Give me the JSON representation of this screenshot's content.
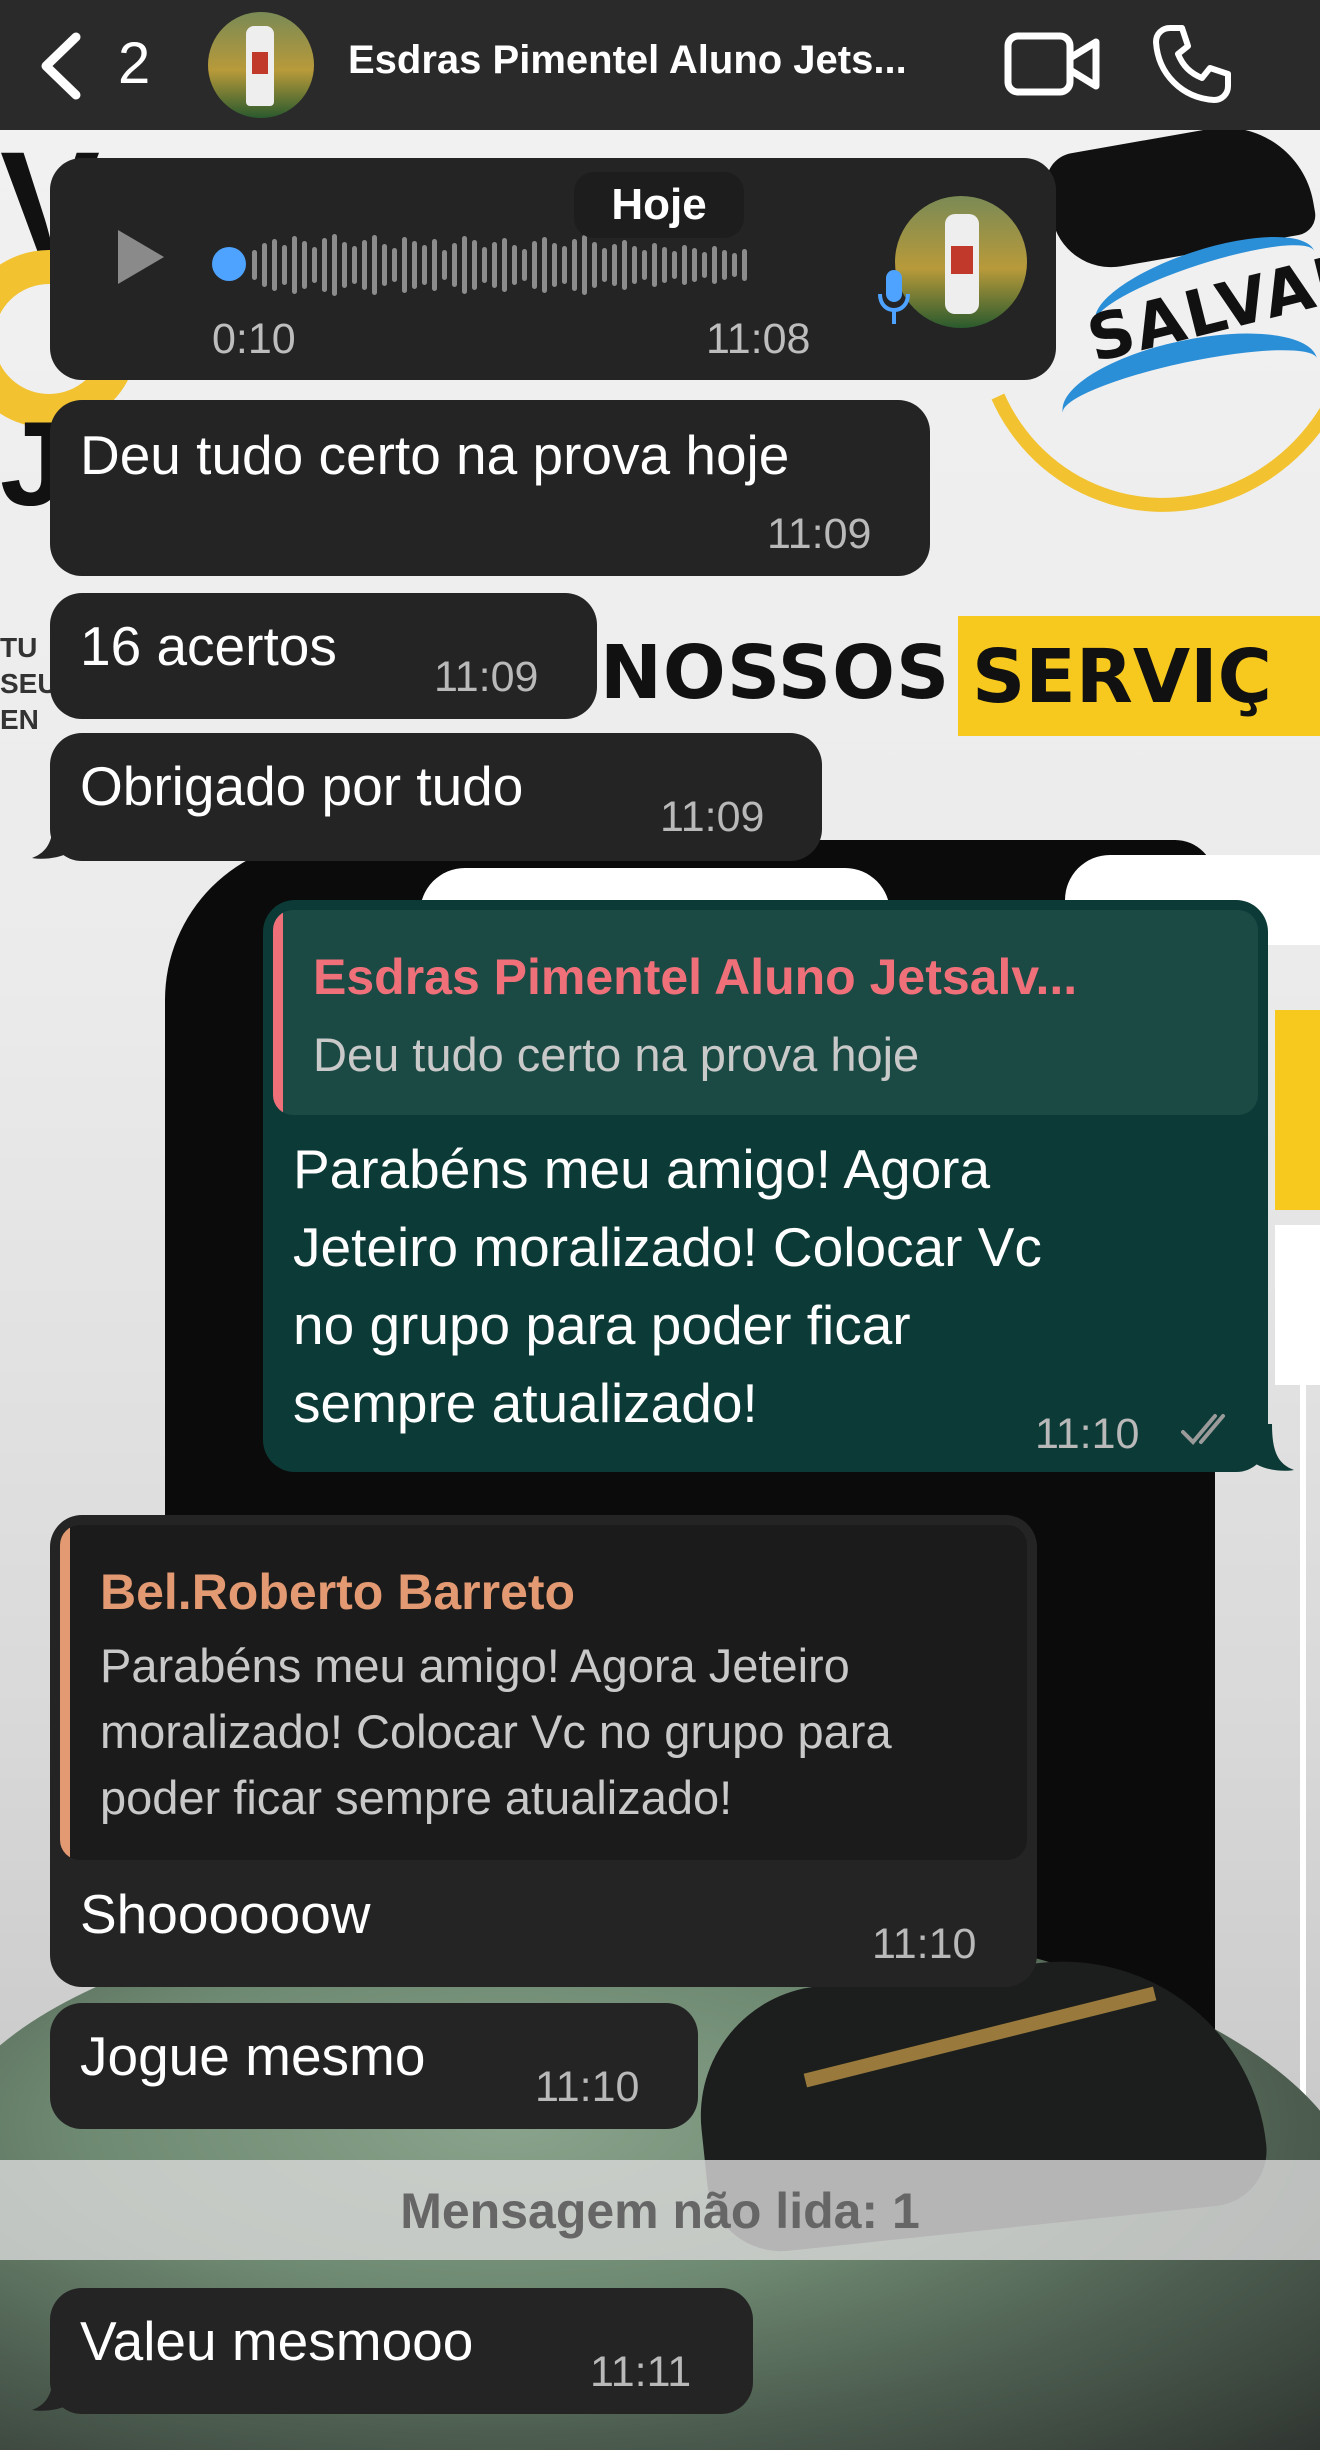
{
  "header": {
    "back_count": "2",
    "title": "Esdras Pimentel Aluno Jets...",
    "icons": {
      "back": "chevron-left-icon",
      "video": "video-camera-icon",
      "call": "phone-icon"
    }
  },
  "date_chip": "Hoje",
  "voice_message": {
    "duration": "0:10",
    "time": "11:08",
    "play_icon": "play-icon",
    "mic_icon": "microphone-icon"
  },
  "messages": [
    {
      "text": "Deu tudo certo na prova hoje",
      "time": "11:09",
      "direction": "in"
    },
    {
      "text": "16 acertos",
      "time": "11:09",
      "direction": "in"
    },
    {
      "text": "Obrigado por tudo",
      "time": "11:09",
      "direction": "in"
    },
    {
      "direction": "out",
      "reply_to": {
        "name": "Esdras Pimentel Aluno Jetsalv...",
        "text": "Deu tudo certo na prova hoje"
      },
      "lines": [
        "Parabéns meu amigo! Agora",
        "Jeteiro moralizado! Colocar Vc",
        "no grupo para poder ficar",
        "sempre atualizado!"
      ],
      "time": "11:10",
      "status_icon": "double-check-icon"
    },
    {
      "direction": "in",
      "reply_to": {
        "name": "Bel.Roberto Barreto",
        "lines": [
          "Parabéns meu amigo! Agora Jeteiro",
          "moralizado! Colocar Vc no grupo para",
          "poder ficar sempre atualizado!"
        ]
      },
      "text": "Shoooooow",
      "time": "11:10"
    },
    {
      "text": "Jogue mesmo",
      "time": "11:10",
      "direction": "in"
    },
    {
      "text": "Valeu mesmooo",
      "time": "11:11",
      "direction": "in"
    }
  ],
  "unread_banner": "Mensagem não lida: 1",
  "colors": {
    "incoming_bubble": "#242424",
    "outgoing_bubble": "#0c3a36",
    "reply_name_out": "#f0707a",
    "reply_name_in": "#e39a72",
    "accent_blue": "#4da3ff"
  }
}
